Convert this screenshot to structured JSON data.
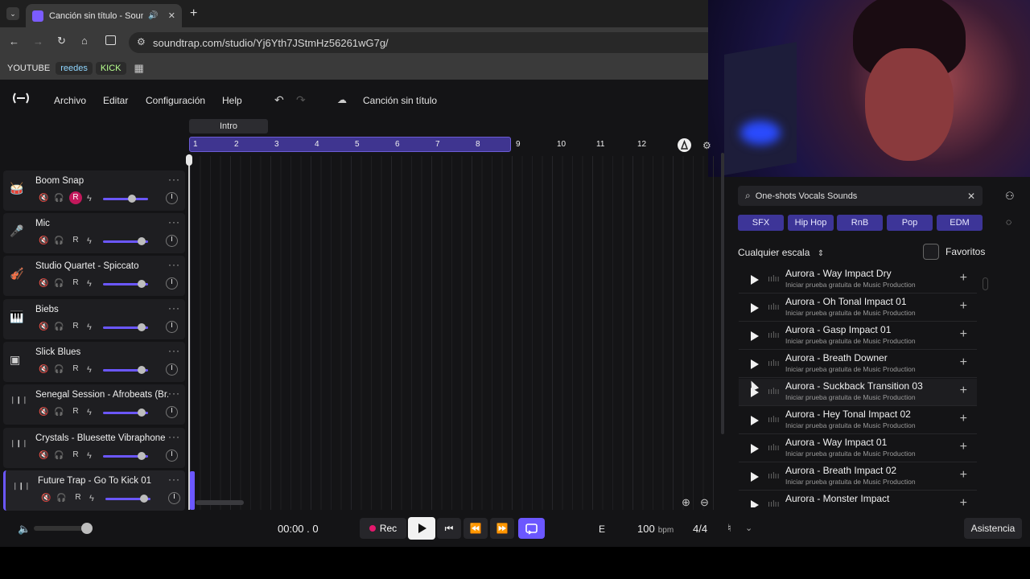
{
  "browser": {
    "tab_title": "Canción sin título - Soundtrap",
    "url": "soundtrap.com/studio/Yj6Yth7JStmHz56261wG7g/",
    "bookmarks": [
      "YOUTUBE",
      "reedes",
      "KICK"
    ]
  },
  "menu": {
    "items": [
      "Archivo",
      "Editar",
      "Configuración",
      "Help"
    ],
    "song_title": "Canción sin título"
  },
  "timeline": {
    "section_label": "Intro",
    "bars": [
      "1",
      "2",
      "3",
      "4",
      "5",
      "6",
      "7",
      "8",
      "9",
      "10",
      "11",
      "12"
    ]
  },
  "tracks": [
    {
      "name": "Boom Snap",
      "rec": "R",
      "armed": true,
      "volume": 0.65
    },
    {
      "name": "Mic",
      "rec": "R",
      "armed": false,
      "volume": 0.85
    },
    {
      "name": "Studio Quartet - Spiccato",
      "rec": "R",
      "armed": false,
      "volume": 0.85
    },
    {
      "name": "Biebs",
      "rec": "R",
      "armed": false,
      "volume": 0.85
    },
    {
      "name": "Slick Blues",
      "rec": "R",
      "armed": false,
      "volume": 0.85
    },
    {
      "name": "Senegal Session - Afrobeats (Br...",
      "rec": "R",
      "armed": false,
      "volume": 0.85
    },
    {
      "name": "Crystals - Bluesette Vibraphone",
      "rec": "R",
      "armed": false,
      "volume": 0.85
    },
    {
      "name": "Future Trap - Go To Kick 01",
      "rec": "R",
      "armed": false,
      "volume": 0.85
    }
  ],
  "browser_panel": {
    "search": "One-shots Vocals Sounds",
    "genres": [
      "SFX",
      "Hip Hop",
      "RnB",
      "Pop",
      "EDM"
    ],
    "scale_label": "Cualquier escala",
    "favorites_label": "Favoritos",
    "sounds": [
      {
        "name": "Aurora - Way Impact Dry",
        "sub": "Iniciar prueba gratuita de Music Production"
      },
      {
        "name": "Aurora - Oh Tonal Impact 01",
        "sub": "Iniciar prueba gratuita de Music Production"
      },
      {
        "name": "Aurora - Gasp Impact 01",
        "sub": "Iniciar prueba gratuita de Music Production"
      },
      {
        "name": "Aurora - Breath Downer",
        "sub": "Iniciar prueba gratuita de Music Production"
      },
      {
        "name": "Aurora - Suckback Transition 03",
        "sub": "Iniciar prueba gratuita de Music Production"
      },
      {
        "name": "Aurora - Hey Tonal Impact 02",
        "sub": "Iniciar prueba gratuita de Music Production"
      },
      {
        "name": "Aurora - Way Impact 01",
        "sub": "Iniciar prueba gratuita de Music Production"
      },
      {
        "name": "Aurora - Breath Impact 02",
        "sub": "Iniciar prueba gratuita de Music Production"
      },
      {
        "name": "Aurora - Monster Impact",
        "sub": ""
      }
    ]
  },
  "transport": {
    "time": "00:00 . 0",
    "rec_label": "Rec",
    "key": "E",
    "bpm": "100",
    "bpm_unit": "bpm",
    "signature": "4/4",
    "help_label": "Asistencia"
  }
}
